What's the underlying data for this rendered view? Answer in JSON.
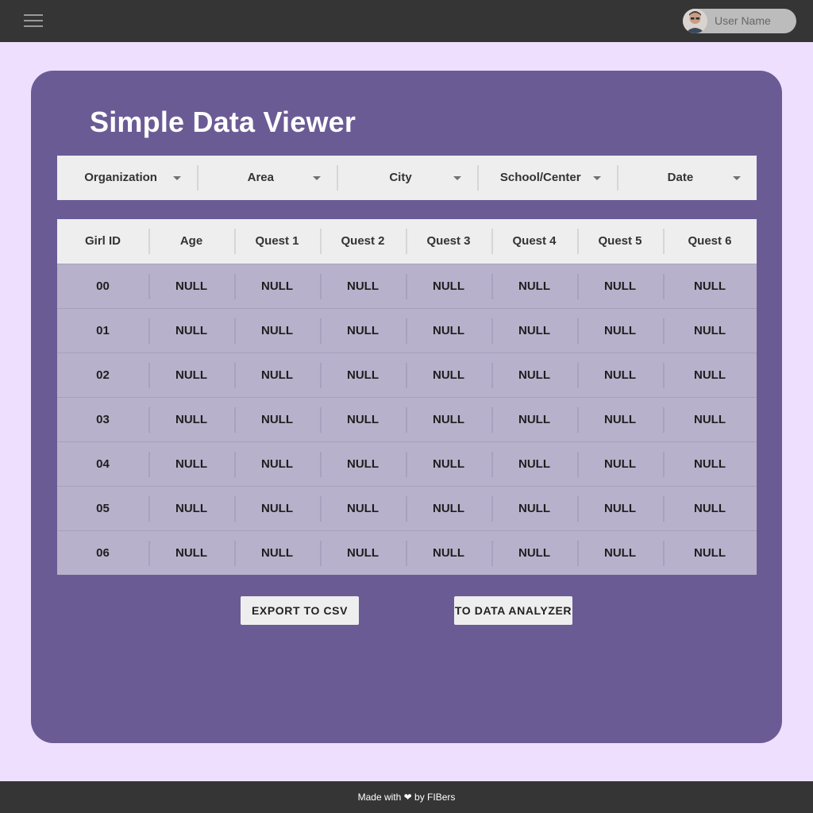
{
  "topbar": {
    "user_name": "User Name"
  },
  "page": {
    "title": "Simple Data Viewer"
  },
  "filters": [
    {
      "label": "Organization"
    },
    {
      "label": "Area"
    },
    {
      "label": "City"
    },
    {
      "label": "School/Center"
    },
    {
      "label": "Date"
    }
  ],
  "table": {
    "columns": [
      "Girl ID",
      "Age",
      "Quest 1",
      "Quest 2",
      "Quest 3",
      "Quest 4",
      "Quest 5",
      "Quest 6"
    ],
    "rows": [
      [
        "00",
        "NULL",
        "NULL",
        "NULL",
        "NULL",
        "NULL",
        "NULL",
        "NULL"
      ],
      [
        "01",
        "NULL",
        "NULL",
        "NULL",
        "NULL",
        "NULL",
        "NULL",
        "NULL"
      ],
      [
        "02",
        "NULL",
        "NULL",
        "NULL",
        "NULL",
        "NULL",
        "NULL",
        "NULL"
      ],
      [
        "03",
        "NULL",
        "NULL",
        "NULL",
        "NULL",
        "NULL",
        "NULL",
        "NULL"
      ],
      [
        "04",
        "NULL",
        "NULL",
        "NULL",
        "NULL",
        "NULL",
        "NULL",
        "NULL"
      ],
      [
        "05",
        "NULL",
        "NULL",
        "NULL",
        "NULL",
        "NULL",
        "NULL",
        "NULL"
      ],
      [
        "06",
        "NULL",
        "NULL",
        "NULL",
        "NULL",
        "NULL",
        "NULL",
        "NULL"
      ]
    ]
  },
  "actions": {
    "export_label": "EXPORT TO CSV",
    "analyzer_label": "TO DATA ANALYZER"
  },
  "footer": {
    "text": "Made with ❤ by FIBers"
  },
  "colors": {
    "page_background": "#efdfff",
    "card": "#6b5b95",
    "topbar": "#353535",
    "table_header": "#eeeeee",
    "table_row": "#b8b1cb"
  },
  "icons": {
    "menu": "hamburger-menu-icon",
    "dropdown": "caret-down-icon",
    "heart": "heart-icon"
  }
}
